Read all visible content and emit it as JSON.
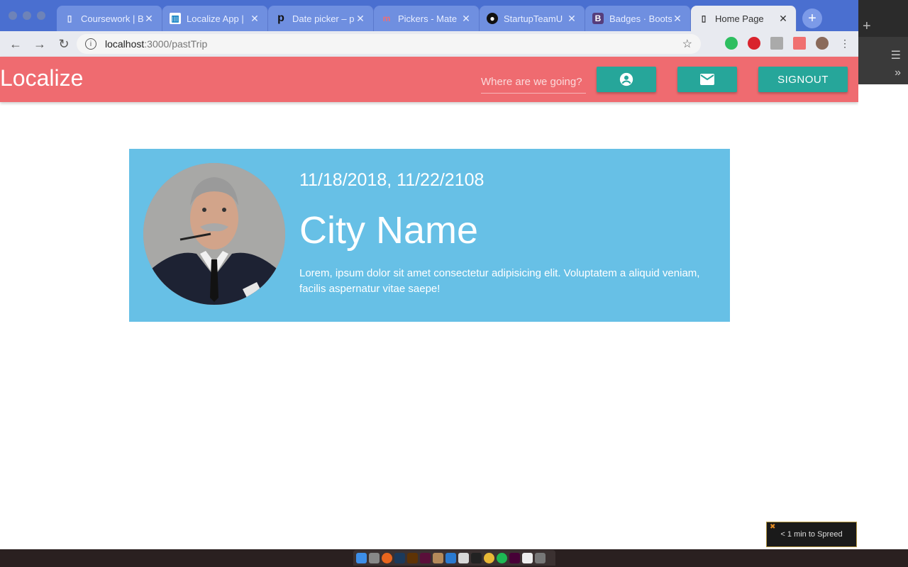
{
  "browser": {
    "tabs": [
      {
        "title": "Coursework | B",
        "icon": "page-icon",
        "active": false
      },
      {
        "title": "Localize App |",
        "icon": "trello-icon",
        "active": false
      },
      {
        "title": "Date picker – p",
        "icon": "p-logo-icon",
        "active": false
      },
      {
        "title": "Pickers - Mate",
        "icon": "materialize-icon",
        "active": false
      },
      {
        "title": "StartupTeamU",
        "icon": "github-icon",
        "active": false
      },
      {
        "title": "Badges · Boots",
        "icon": "bootstrap-icon",
        "active": false
      },
      {
        "title": "Home Page",
        "icon": "page-icon",
        "active": true
      }
    ],
    "url_host": "localhost",
    "url_path": ":3000/pastTrip"
  },
  "header": {
    "title": "Localize",
    "search_placeholder": "Where are we going?",
    "signout_label": "SIGNOUT"
  },
  "trip": {
    "dates": "11/18/2018, 11/22/2108",
    "city": "City Name",
    "description": "Lorem, ipsum dolor sit amet consectetur adipisicing elit. Voluptatem a aliquid veniam, facilis aspernatur vitae saepe!"
  },
  "widget": {
    "spreed_text": "< 1 min to Spreed"
  },
  "colors": {
    "header": "#ef6b70",
    "button": "#26a69a",
    "card": "#67c0e6"
  }
}
